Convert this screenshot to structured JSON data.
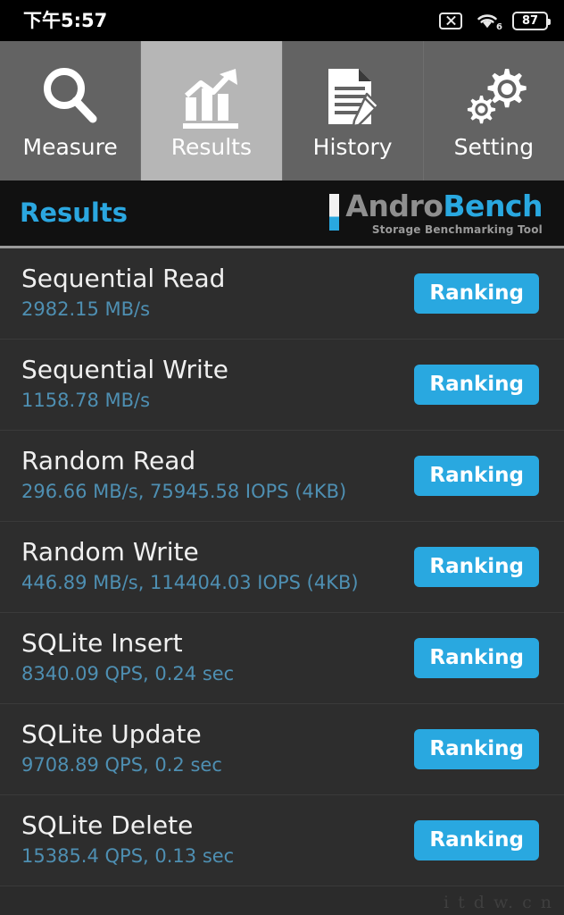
{
  "statusbar": {
    "time": "下午5:57",
    "nosim_icon": "no-sim-icon",
    "wifi_icon": "wifi-icon",
    "wifi_generation": "6",
    "battery_icon": "battery-icon",
    "battery_level": "87"
  },
  "tabs": [
    {
      "label": "Measure",
      "icon": "magnifier-icon",
      "selected": false
    },
    {
      "label": "Results",
      "icon": "bar-chart-arrow-icon",
      "selected": true
    },
    {
      "label": "History",
      "icon": "document-pencil-icon",
      "selected": false
    },
    {
      "label": "Setting",
      "icon": "gears-icon",
      "selected": false
    }
  ],
  "header": {
    "title": "Results",
    "logo_primary": "Andro",
    "logo_secondary": "Bench",
    "logo_tagline": "Storage Benchmarking Tool"
  },
  "results": [
    {
      "name": "Sequential Read",
      "value": "2982.15 MB/s",
      "button": "Ranking"
    },
    {
      "name": "Sequential Write",
      "value": "1158.78 MB/s",
      "button": "Ranking"
    },
    {
      "name": "Random Read",
      "value": "296.66 MB/s, 75945.58 IOPS (4KB)",
      "button": "Ranking"
    },
    {
      "name": "Random Write",
      "value": "446.89 MB/s, 114404.03 IOPS (4KB)",
      "button": "Ranking"
    },
    {
      "name": "SQLite Insert",
      "value": "8340.09 QPS, 0.24 sec",
      "button": "Ranking"
    },
    {
      "name": "SQLite Update",
      "value": "9708.89 QPS, 0.2 sec",
      "button": "Ranking"
    },
    {
      "name": "SQLite Delete",
      "value": "15385.4 QPS, 0.13 sec",
      "button": "Ranking"
    }
  ],
  "watermark": "i t d w.  c n",
  "colors": {
    "accent_blue": "#29a8e0",
    "value_blue": "#4e8fb2",
    "tab_bg": "#636363",
    "tab_selected_bg": "#b6b6b6",
    "list_bg": "#2d2d2d",
    "header_bg": "#111111"
  }
}
